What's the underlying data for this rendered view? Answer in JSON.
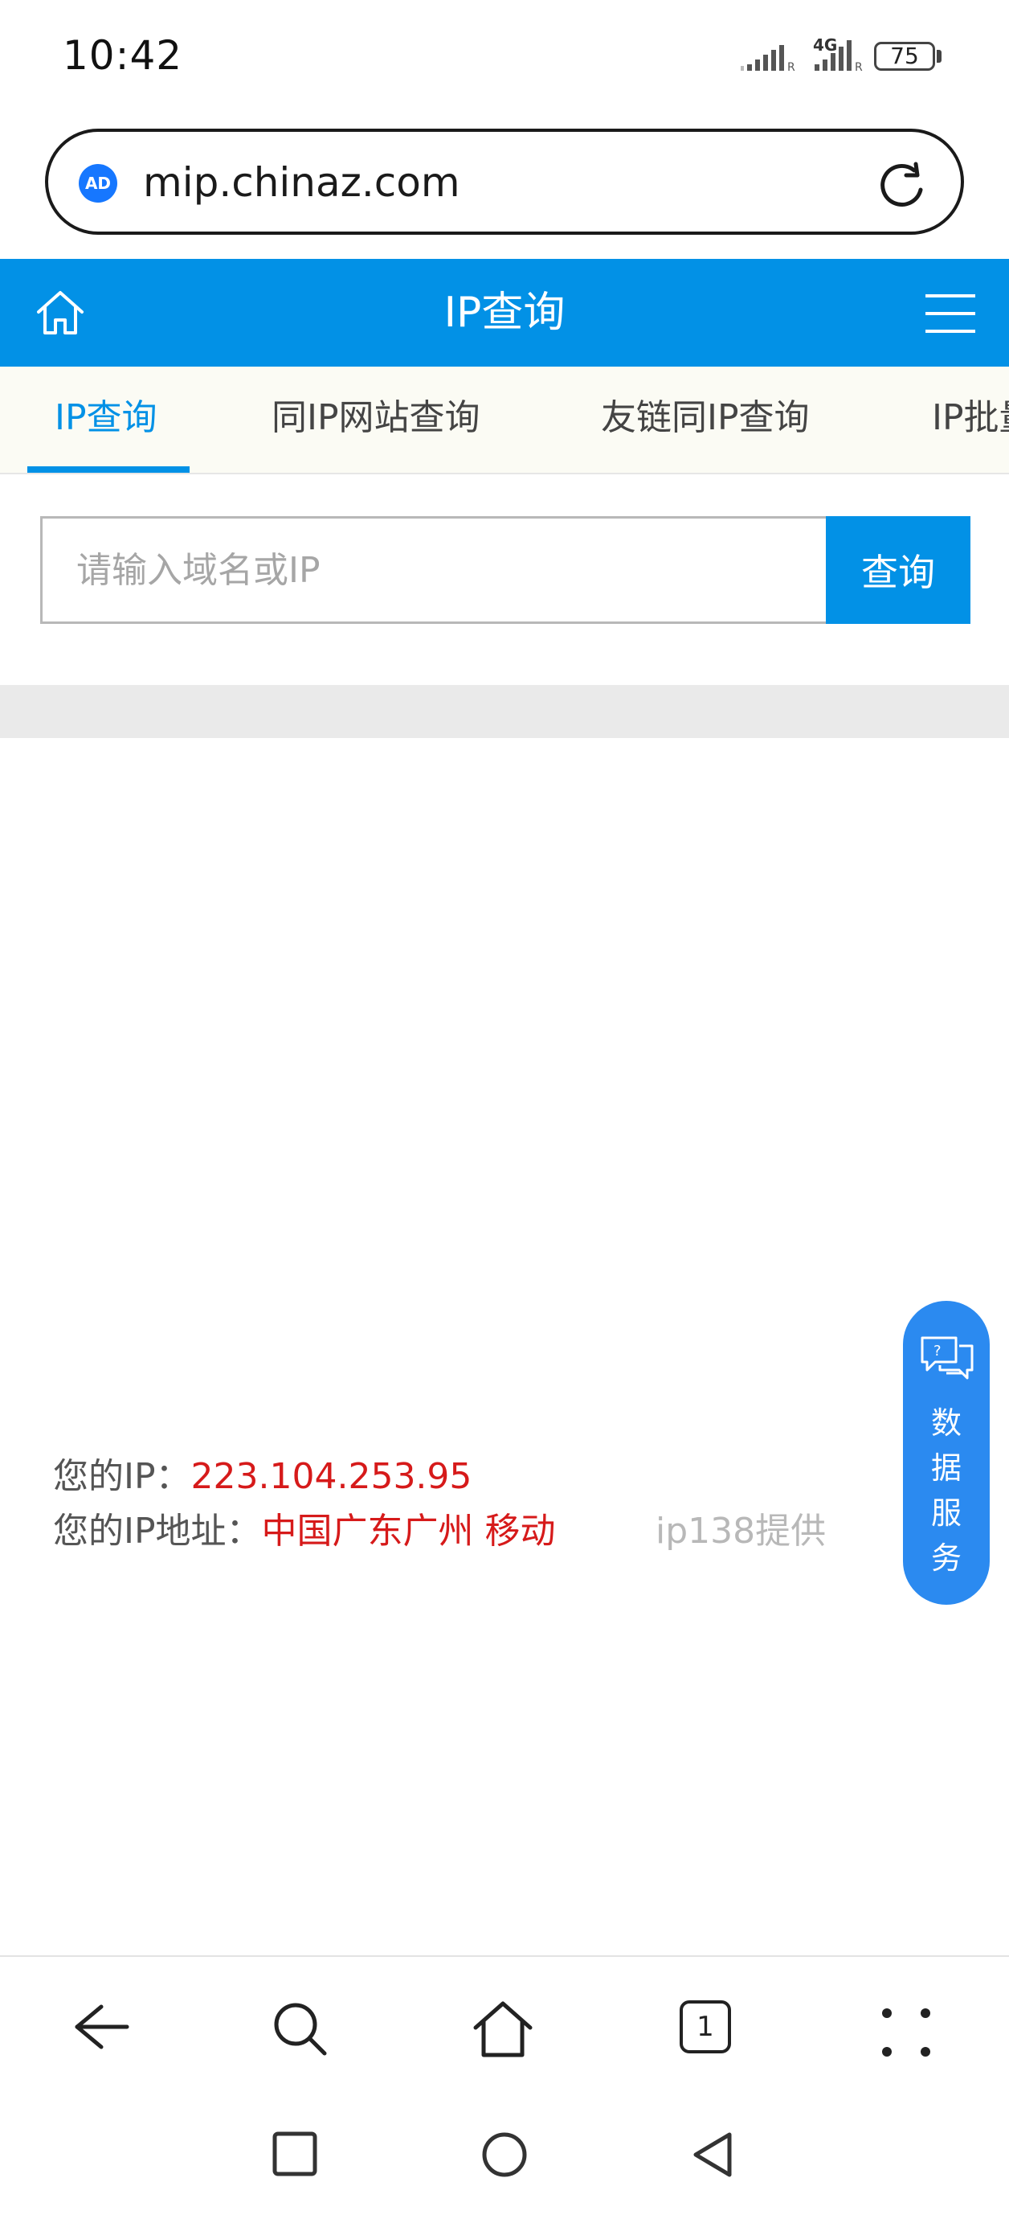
{
  "status_bar": {
    "time": "10:42",
    "network_label": "4G",
    "battery": "75"
  },
  "address_bar": {
    "ad_badge": "AD",
    "url": "mip.chinaz.com"
  },
  "header": {
    "title": "IP查询"
  },
  "tabs": [
    {
      "label": "IP查询",
      "active": true
    },
    {
      "label": "同IP网站查询",
      "active": false
    },
    {
      "label": "友链同IP查询",
      "active": false
    },
    {
      "label": "IP批量查询",
      "active": false
    }
  ],
  "search": {
    "placeholder": "请输入域名或IP",
    "value": "",
    "button_label": "查询"
  },
  "ip_info": {
    "ip_label": "您的IP：",
    "ip_value": "223.104.253.95",
    "address_label": "您的IP地址：",
    "address_value": "中国广东广州 移动",
    "provider": "ip138提供"
  },
  "data_service": {
    "label": "数据服务",
    "chars": [
      "数",
      "据",
      "服",
      "务"
    ]
  },
  "bottom_bar": {
    "tab_count": "1"
  },
  "colors": {
    "brand_blue": "#0291e6",
    "value_red": "#d61a1a",
    "service_blue": "#2b8af0"
  },
  "icons": [
    "ad-icon",
    "reload-icon",
    "home-icon",
    "menu-icon",
    "chat-icon",
    "back-icon",
    "search-icon",
    "home-icon",
    "tabs-icon",
    "more-icon",
    "recent-apps-icon",
    "home-circle-icon",
    "back-triangle-icon"
  ]
}
